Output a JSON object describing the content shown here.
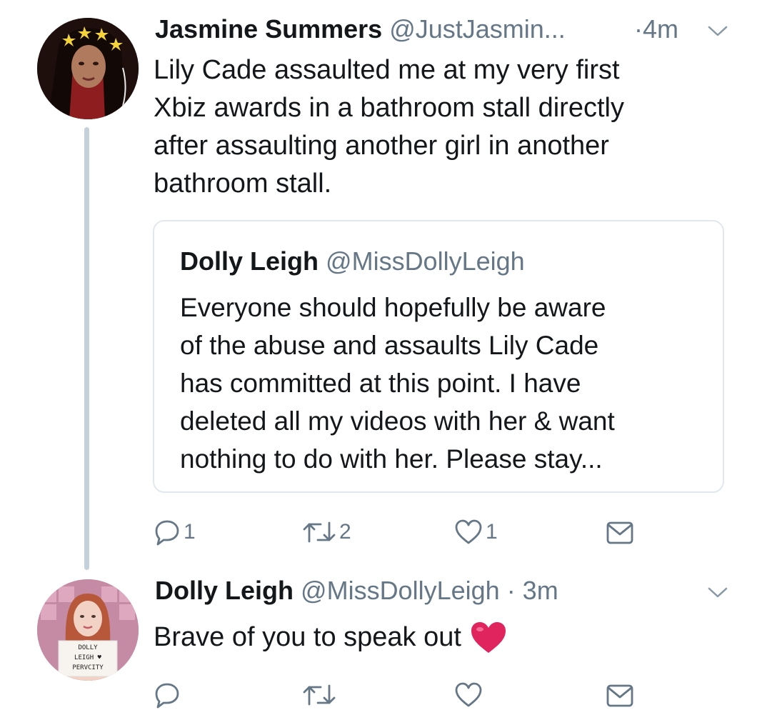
{
  "tweet1": {
    "name": "Jasmine Summers",
    "handle": "@JustJasmin...",
    "time": "·4m",
    "lines": [
      "Lily Cade assaulted me at my very first",
      "Xbiz awards in a bathroom stall directly",
      "after assaulting another girl in another",
      "bathroom stall."
    ],
    "quote": {
      "name": "Dolly Leigh",
      "handle": "@MissDollyLeigh",
      "lines": [
        "Everyone should hopefully be aware",
        "of the abuse and assaults Lily Cade",
        "has committed at this point. I have",
        "deleted all my videos with her & want",
        "nothing to do with her. Please stay..."
      ]
    },
    "actions": {
      "reply_count": "1",
      "retweet_count": "2",
      "like_count": "1"
    }
  },
  "tweet2": {
    "name": "Dolly Leigh",
    "handle": "@MissDollyLeigh",
    "time": "· 3m",
    "text": "Brave of you to speak out",
    "emoji": "heart-emoji",
    "avatar_sign": [
      "DOLLY",
      "LEIGH ♥",
      "PERVCITY"
    ]
  },
  "icons": {
    "reply": "reply-icon",
    "retweet": "retweet-icon",
    "like": "like-icon",
    "dm": "direct-message-icon",
    "caret": "chevron-down-icon"
  },
  "colors": {
    "text": "#14171a",
    "secondary": "#657786",
    "thread_line": "#c4d0da",
    "border": "#e1e8ed",
    "heart": "#e0245e"
  }
}
